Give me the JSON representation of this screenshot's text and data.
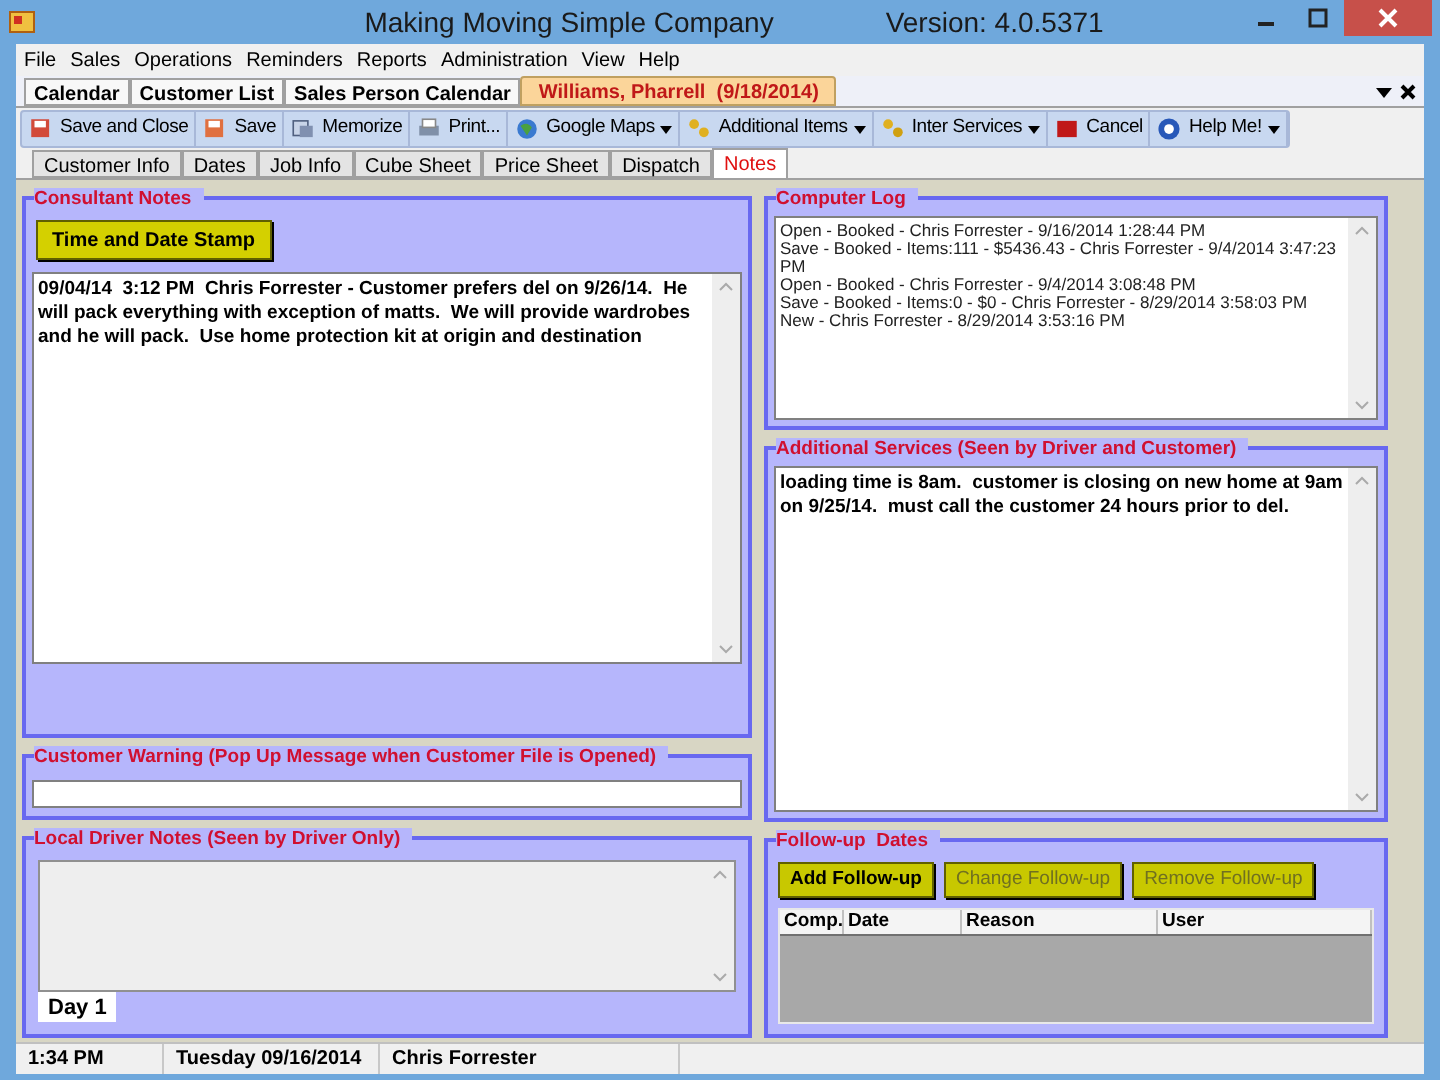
{
  "window": {
    "title": "Making Moving Simple Company",
    "version": "Version: 4.0.5371"
  },
  "menu": [
    "File",
    "Sales",
    "Operations",
    "Reminders",
    "Reports",
    "Administration",
    "View",
    "Help"
  ],
  "doc_tabs": [
    {
      "label": "Calendar",
      "selected": false
    },
    {
      "label": "Customer List",
      "selected": false
    },
    {
      "label": "Sales Person Calendar",
      "selected": false
    },
    {
      "label": "Williams, Pharrell  (9/18/2014)",
      "selected": true
    }
  ],
  "toolbar": [
    {
      "label": "Save and Close",
      "dropdown": false
    },
    {
      "label": "Save",
      "dropdown": false
    },
    {
      "label": "Memorize",
      "dropdown": false
    },
    {
      "label": "Print...",
      "dropdown": false
    },
    {
      "label": "Google Maps",
      "dropdown": true
    },
    {
      "label": "Additional Items",
      "dropdown": true
    },
    {
      "label": "Inter Services",
      "dropdown": true
    },
    {
      "label": "Cancel",
      "dropdown": false
    },
    {
      "label": "Help Me!",
      "dropdown": true
    }
  ],
  "tabs": [
    {
      "label": "Customer Info",
      "selected": false
    },
    {
      "label": "Dates",
      "selected": false
    },
    {
      "label": "Job Info",
      "selected": false
    },
    {
      "label": "Cube Sheet",
      "selected": false
    },
    {
      "label": "Price Sheet",
      "selected": false
    },
    {
      "label": "Dispatch",
      "selected": false
    },
    {
      "label": "Notes",
      "selected": true
    }
  ],
  "consultant_notes": {
    "title": "Consultant Notes",
    "button": "Time and Date Stamp",
    "text": "09/04/14  3:12 PM  Chris Forrester - Customer prefers del on 9/26/14.  He will pack everything with exception of matts.  We will provide wardrobes and he will pack.  Use home protection kit at origin and destination"
  },
  "customer_warning": {
    "title": "Customer Warning (Pop Up Message when Customer File is Opened)"
  },
  "local_driver_notes": {
    "title": "Local Driver Notes (Seen by Driver Only)",
    "tabs": [
      {
        "label": "Day 1",
        "selected": true
      }
    ]
  },
  "computer_log": {
    "title": "Computer Log",
    "lines": [
      "Open - Booked - Chris Forrester - 9/16/2014 1:28:44 PM",
      "Save - Booked - Items:111 - $5436.43 - Chris Forrester - 9/4/2014 3:47:23 PM",
      "Open - Booked - Chris Forrester - 9/4/2014 3:08:48 PM",
      "Save - Booked - Items:0 - $0 - Chris Forrester - 8/29/2014 3:58:03 PM",
      "New - Chris Forrester - 8/29/2014 3:53:16 PM"
    ]
  },
  "additional_services": {
    "title": "Additional Services (Seen by Driver and Customer)",
    "text": "loading time is 8am.  customer is closing on new home at 9am on 9/25/14.  must call the customer 24 hours prior to del."
  },
  "follow_up": {
    "title": "Follow-up  Dates",
    "buttons": [
      {
        "label": "Add Follow-up",
        "disabled": false
      },
      {
        "label": "Change Follow-up",
        "disabled": true
      },
      {
        "label": "Remove Follow-up",
        "disabled": true
      }
    ],
    "columns": [
      "Comp.",
      "Date",
      "Reason",
      "User"
    ]
  },
  "status_bar": [
    "1:34 PM",
    "Tuesday 09/16/2014",
    "Chris Forrester"
  ]
}
